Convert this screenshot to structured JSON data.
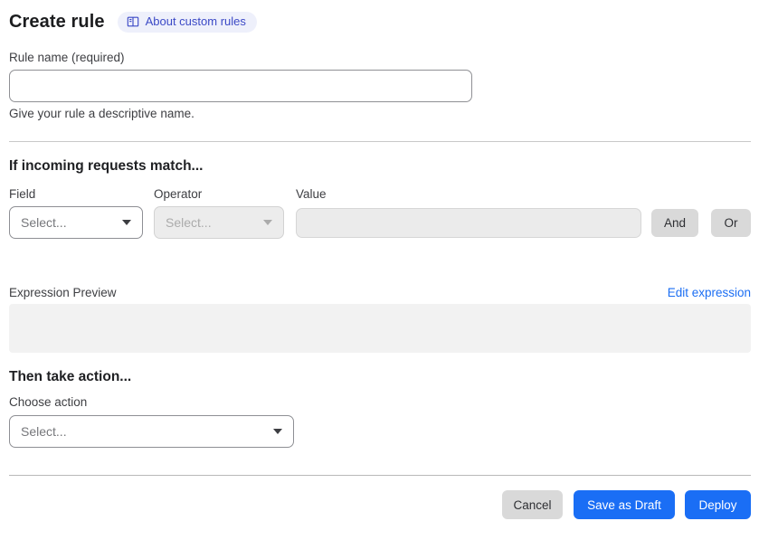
{
  "page": {
    "title": "Create rule",
    "about_badge_label": "About custom rules"
  },
  "rule_name": {
    "label": "Rule name (required)",
    "value": "",
    "helper": "Give your rule a descriptive name."
  },
  "match_section": {
    "heading": "If incoming requests match...",
    "field_label": "Field",
    "operator_label": "Operator",
    "value_label": "Value",
    "field_placeholder": "Select...",
    "operator_placeholder": "Select...",
    "value_value": "",
    "and_button_label": "And",
    "or_button_label": "Or",
    "expression_preview_label": "Expression Preview",
    "edit_expression_link": "Edit expression",
    "expression_preview_value": ""
  },
  "action_section": {
    "heading": "Then take action...",
    "choose_action_label": "Choose action",
    "action_placeholder": "Select..."
  },
  "footer": {
    "cancel_label": "Cancel",
    "save_draft_label": "Save as Draft",
    "deploy_label": "Deploy"
  },
  "icons": {
    "badge_icon": "book-icon",
    "select_caret": "chevron-down-icon"
  },
  "colors": {
    "primary_blue": "#1a6ef5",
    "link_blue": "#1b6ef3",
    "badge_bg": "#eef0fb",
    "badge_text": "#3b49c6",
    "gray_button_bg": "#d9d9d9",
    "disabled_bg": "#ececec",
    "preview_box_bg": "#f2f2f2",
    "divider": "#c9c9c9"
  }
}
